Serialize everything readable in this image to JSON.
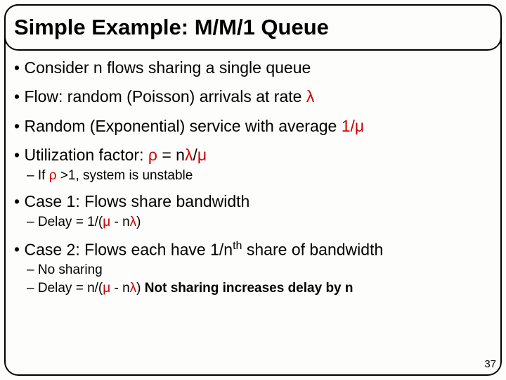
{
  "title": "Simple Example: M/M/1 Queue",
  "bullets": {
    "b1": "Consider n flows sharing a single queue",
    "b2a": "Flow: random (Poisson) arrivals at rate ",
    "b2b": "λ",
    "b3a": "Random (Exponential) service with average ",
    "b3b": "1/μ",
    "b4a": "Utilization factor: ",
    "b4b": "ρ",
    "b4c": " = n",
    "b4d": "λ",
    "b4e": "/",
    "b4f": "μ",
    "b4s1a": "If ",
    "b4s1b": "ρ",
    "b4s1c": " >1, system is unstable",
    "b5": "Case 1: Flows share bandwidth",
    "b5s1a": "Delay = 1/(",
    "b5s1b": "μ",
    "b5s1c": " - n",
    "b5s1d": "λ",
    "b5s1e": ")",
    "b6a": "Case 2: Flows each have 1/n",
    "b6b": "th",
    "b6c": " share of bandwidth",
    "b6s1": "No sharing",
    "b6s2a": "Delay = n/(",
    "b6s2b": "μ",
    "b6s2c": " - n",
    "b6s2d": "λ",
    "b6s2e": ") ",
    "b6s2f": "Not sharing increases delay by n"
  },
  "pageNumber": "37"
}
